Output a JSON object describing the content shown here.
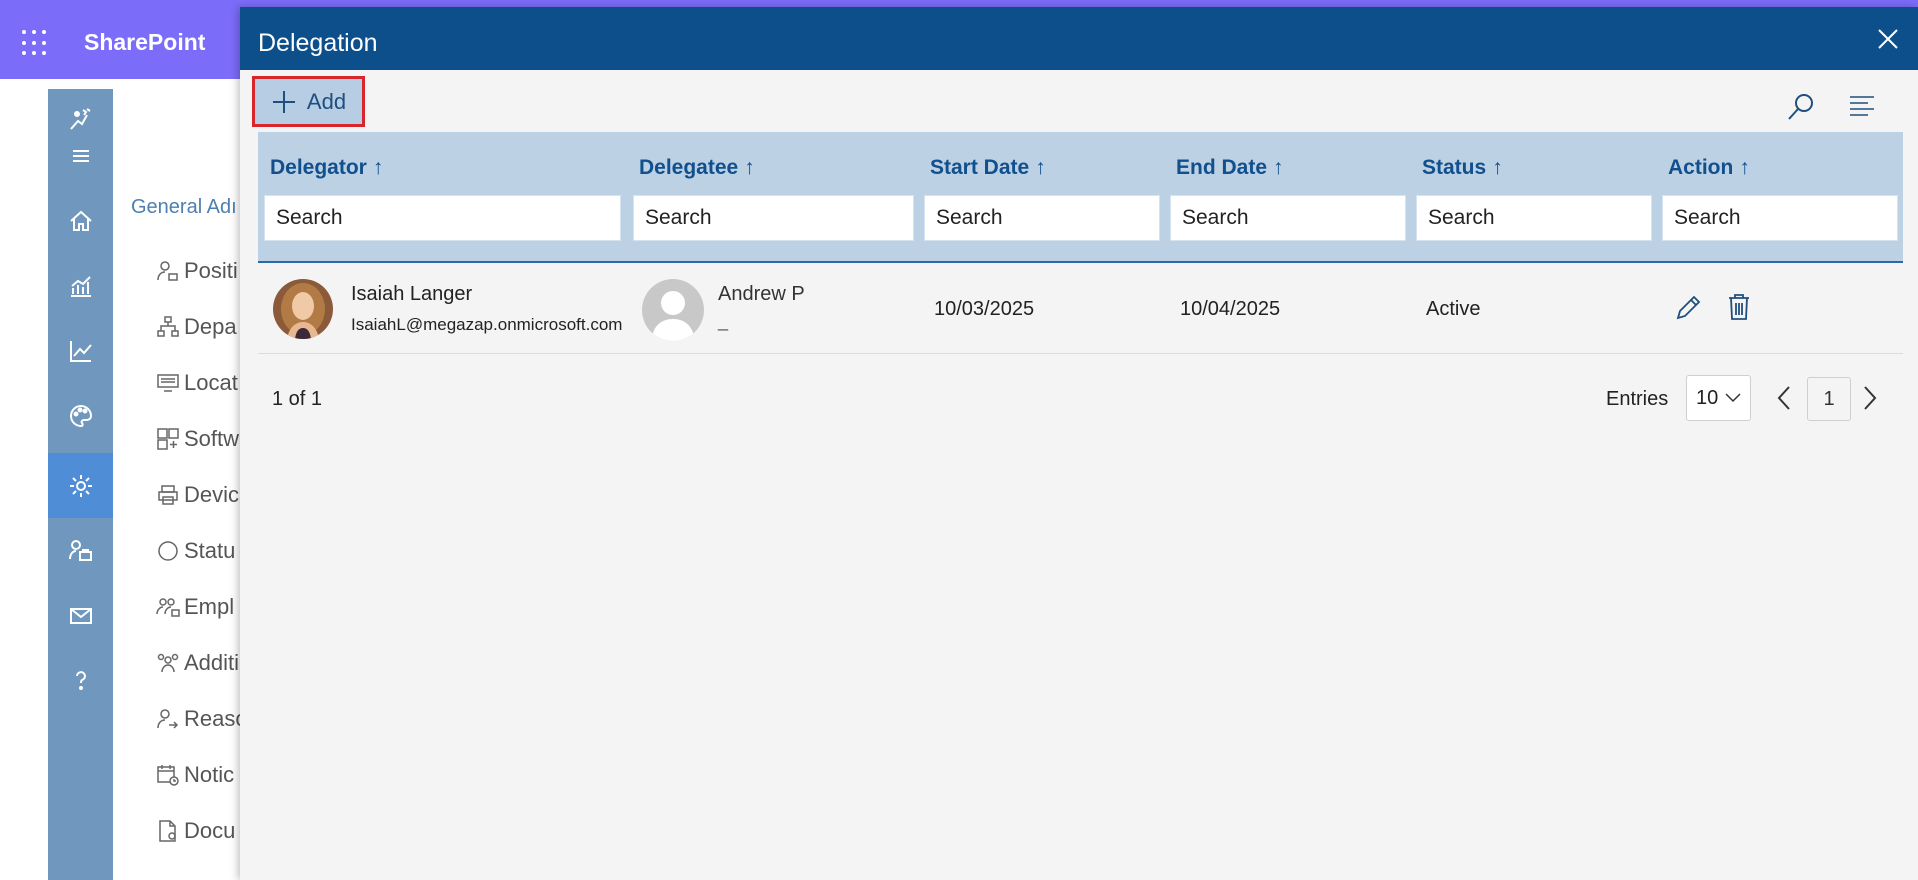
{
  "suitebar": {
    "brand": "SharePoint"
  },
  "rail": {
    "items": [
      {
        "icon": "logo-icon"
      },
      {
        "icon": "hamburger-menu-icon"
      },
      {
        "icon": "home-icon"
      },
      {
        "icon": "bar-chart-icon"
      },
      {
        "icon": "line-chart-icon"
      },
      {
        "icon": "palette-icon"
      },
      {
        "icon": "settings-gear-icon",
        "active": true
      },
      {
        "icon": "user-org-icon"
      },
      {
        "icon": "mail-icon"
      },
      {
        "icon": "help-question-icon"
      }
    ]
  },
  "settings_nav": {
    "heading": "General Adı",
    "items": [
      {
        "label": "Positi",
        "icon": "person-icon"
      },
      {
        "label": "Depa",
        "icon": "org-chart-icon"
      },
      {
        "label": "Locat",
        "icon": "location-icon"
      },
      {
        "label": "Softw",
        "icon": "grid-add-icon"
      },
      {
        "label": "Devic",
        "icon": "printer-icon"
      },
      {
        "label": "Statu",
        "icon": "circle-icon"
      },
      {
        "label": "Empl",
        "icon": "people-icon"
      },
      {
        "label": "Additi",
        "icon": "team-add-icon"
      },
      {
        "label": "Reaso",
        "icon": "person-arrow-icon"
      },
      {
        "label": "Notic",
        "icon": "calendar-clock-icon"
      },
      {
        "label": "Docu",
        "icon": "document-settings-icon"
      }
    ]
  },
  "panel": {
    "title": "Delegation",
    "add_label": "Add",
    "columns": [
      {
        "label": "Delegator",
        "sort": "↑",
        "search_placeholder": "Search"
      },
      {
        "label": "Delegatee",
        "sort": "↑",
        "search_placeholder": "Search"
      },
      {
        "label": "Start Date",
        "sort": "↑",
        "search_placeholder": "Search"
      },
      {
        "label": "End Date",
        "sort": "↑",
        "search_placeholder": "Search"
      },
      {
        "label": "Status",
        "sort": "↑",
        "search_placeholder": "Search"
      },
      {
        "label": "Action",
        "sort": "↑",
        "search_placeholder": "Search"
      }
    ],
    "rows": [
      {
        "delegator_name": "Isaiah Langer",
        "delegator_email": "IsaiahL@megazap.onmicrosoft.com",
        "delegatee_name": "Andrew P",
        "delegatee_email": "_",
        "start_date": "10/03/2025",
        "end_date": "10/04/2025",
        "status": "Active"
      }
    ],
    "paging": {
      "summary": "1 of 1",
      "entries_label": "Entries",
      "entries_value": "10",
      "current_page": "1"
    }
  },
  "colors": {
    "suitebar": "#7b6dfa",
    "rail": "#7097bd",
    "panel_header": "#0d4f8b",
    "table_header": "#bdd1e5",
    "accent_text": "#114f8d",
    "highlight_border": "#d9262c"
  }
}
